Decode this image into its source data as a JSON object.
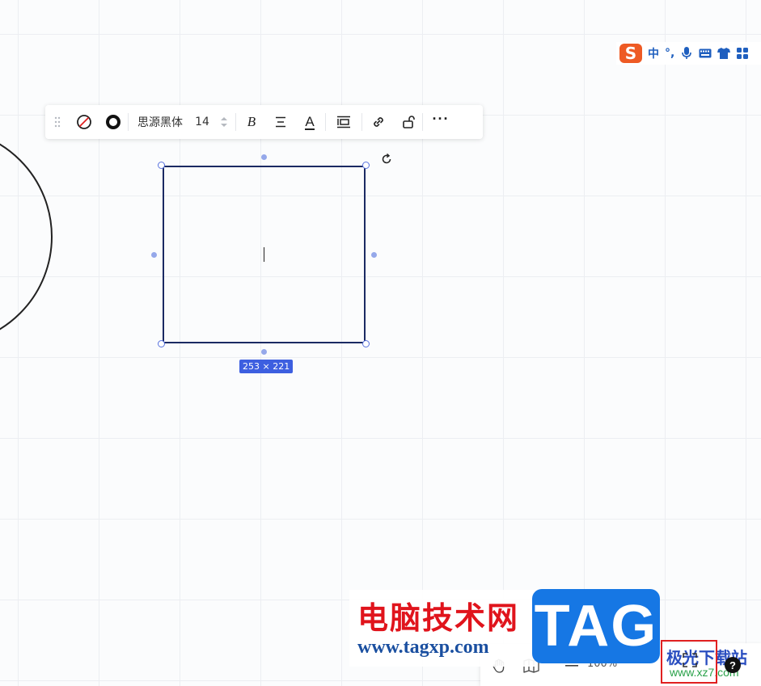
{
  "ime": {
    "logo": "S",
    "mode_label": "中",
    "punct_label": "°,"
  },
  "toolbar": {
    "font_name": "思源黑体",
    "font_size": "14",
    "bold_label": "B",
    "font_color_label": "A",
    "more_label": "···"
  },
  "canvas": {
    "size_label": "253 × 221"
  },
  "bottom_bar": {
    "zoom_label": "100%",
    "help_label": "?"
  },
  "watermarks": {
    "site_title": "电脑技术网",
    "site_url": "www.tagxp.com",
    "tag_logo": "TAG",
    "xz7_title": "极光下载站",
    "xz7_url": "www.xz7.com"
  },
  "colors": {
    "accent": "#3d5fe0",
    "shape_stroke": "#1b2a63",
    "highlight": "#e02020"
  }
}
